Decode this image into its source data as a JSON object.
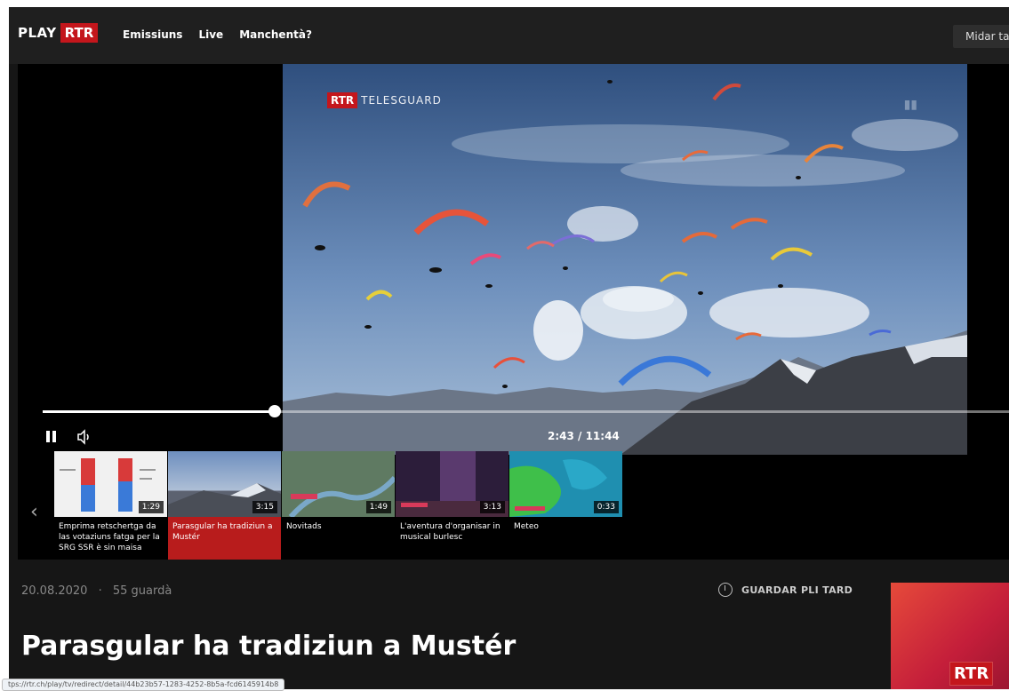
{
  "header": {
    "brand_play": "PLAY",
    "brand_rtr": "RTR",
    "nav": [
      "Emissiuns",
      "Live",
      "Manchentà?"
    ],
    "search_label": "Midar ta"
  },
  "player": {
    "channel_brand": "RTR",
    "channel_name": "TELESGUARD",
    "progress_fraction": 0.24,
    "timecode": "2:43 / 11:44"
  },
  "thumbnails": [
    {
      "title": "Emprima retschertga da las votaziuns fatga per la SRG SSR è sin maisa",
      "duration": "1:29",
      "active": false
    },
    {
      "title": "Parasgular ha tradiziun a Mustér",
      "duration": "3:15",
      "active": true
    },
    {
      "title": "Novitads",
      "duration": "1:49",
      "active": false
    },
    {
      "title": "L'aventura d'organisar in musical burlesc",
      "duration": "3:13",
      "active": false
    },
    {
      "title": "Meteo",
      "duration": "0:33",
      "active": false
    }
  ],
  "info": {
    "date": "20.08.2020",
    "separator": "·",
    "views": "55 guardà",
    "watch_later": "GUARDAR PLI TARD",
    "title": "Parasgular ha tradiziun a Mustér",
    "side_logo": "RTR"
  },
  "status_url": "tps://rtr.ch/play/tv/redirect/detail/44b23b57-1283-4252-8b5a-fcd6145914b8"
}
